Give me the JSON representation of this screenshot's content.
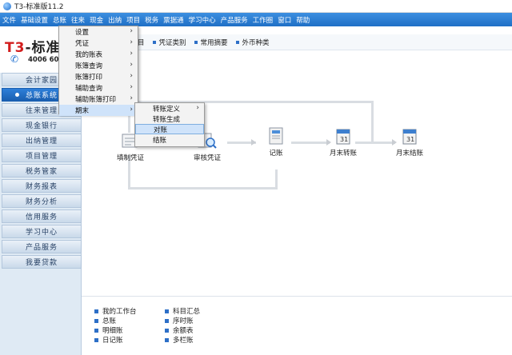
{
  "window": {
    "title": "T3-标准版11.2"
  },
  "menubar": [
    "文件",
    "基础设置",
    "总账",
    "往来",
    "现金",
    "出纳",
    "项目",
    "税务",
    "票据通",
    "学习中心",
    "产品服务",
    "工作圈",
    "窗口",
    "帮助"
  ],
  "logo": {
    "title_prefix": "T3",
    "title_rest": "-标准",
    "phone": "4006 60"
  },
  "toolbar": [
    "目",
    "凭证类别",
    "常用摘要",
    "外币种类"
  ],
  "sidebar": {
    "items": [
      {
        "label": "会计家园",
        "active": false
      },
      {
        "label": "总账系统",
        "active": true
      },
      {
        "label": "往来管理",
        "active": false
      },
      {
        "label": "现金银行",
        "active": false
      },
      {
        "label": "出纳管理",
        "active": false
      },
      {
        "label": "项目管理",
        "active": false
      },
      {
        "label": "税务管家",
        "active": false
      },
      {
        "label": "财务报表",
        "active": false
      },
      {
        "label": "财务分析",
        "active": false
      },
      {
        "label": "信用服务",
        "active": false
      },
      {
        "label": "学习中心",
        "active": false
      },
      {
        "label": "产品服务",
        "active": false
      },
      {
        "label": "我要贷款",
        "active": false
      }
    ]
  },
  "flow": {
    "nodes": [
      "填制凭证",
      "审核凭证",
      "记账",
      "月末转账",
      "月末结账"
    ]
  },
  "quick_links": {
    "left": [
      "我的工作台",
      "总账",
      "明细账",
      "日记账"
    ],
    "right": [
      "科目汇总",
      "序时账",
      "余额表",
      "多栏账"
    ]
  },
  "menu_dropdown": {
    "items": [
      "设置",
      "凭证",
      "我的账表",
      "账簿查询",
      "账簿打印",
      "辅助查询",
      "辅助账簿打印",
      "期末"
    ],
    "highlighted": "期末"
  },
  "submenu": {
    "items": [
      "转账定义",
      "转账生成",
      "对账",
      "结账"
    ],
    "highlighted": "对账"
  },
  "colors": {
    "menubar": "#2a7dd3",
    "sidebar_active": "#1f6fc6",
    "menu_highlight": "#cfe3fa"
  }
}
